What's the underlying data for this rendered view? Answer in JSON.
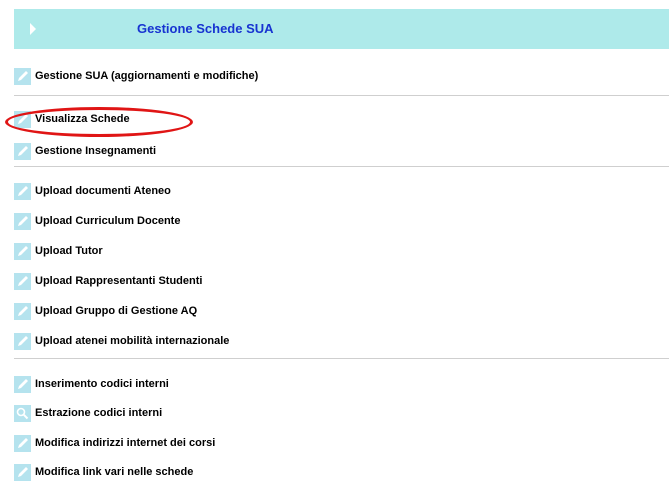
{
  "header": {
    "title": "Gestione Schede SUA",
    "chevron_icon": "chevron-right-icon"
  },
  "menu": [
    {
      "label": "Gestione SUA (aggiornamenti e modifiche)",
      "icon": "pencil-icon"
    },
    {
      "label": "Visualizza Schede",
      "icon": "pencil-icon",
      "highlighted": true
    },
    {
      "label": "Gestione Insegnamenti",
      "icon": "pencil-icon"
    },
    {
      "label": "Upload documenti Ateneo",
      "icon": "pencil-icon"
    },
    {
      "label": "Upload Curriculum Docente",
      "icon": "pencil-icon"
    },
    {
      "label": "Upload Tutor",
      "icon": "pencil-icon"
    },
    {
      "label": "Upload Rappresentanti Studenti",
      "icon": "pencil-icon"
    },
    {
      "label": "Upload Gruppo di Gestione AQ",
      "icon": "pencil-icon"
    },
    {
      "label": "Upload atenei mobilità internazionale",
      "icon": "pencil-icon"
    },
    {
      "label": "Inserimento codici interni",
      "icon": "pencil-icon"
    },
    {
      "label": "Estrazione codici interni",
      "icon": "search-icon"
    },
    {
      "label": "Modifica indirizzi internet dei corsi",
      "icon": "pencil-icon"
    },
    {
      "label": "Modifica link vari nelle schede",
      "icon": "pencil-icon"
    }
  ],
  "colors": {
    "header_bg": "#aeeaea",
    "header_title": "#1733d1",
    "icon_bg": "#b5e3ee",
    "highlight": "#e01515"
  }
}
